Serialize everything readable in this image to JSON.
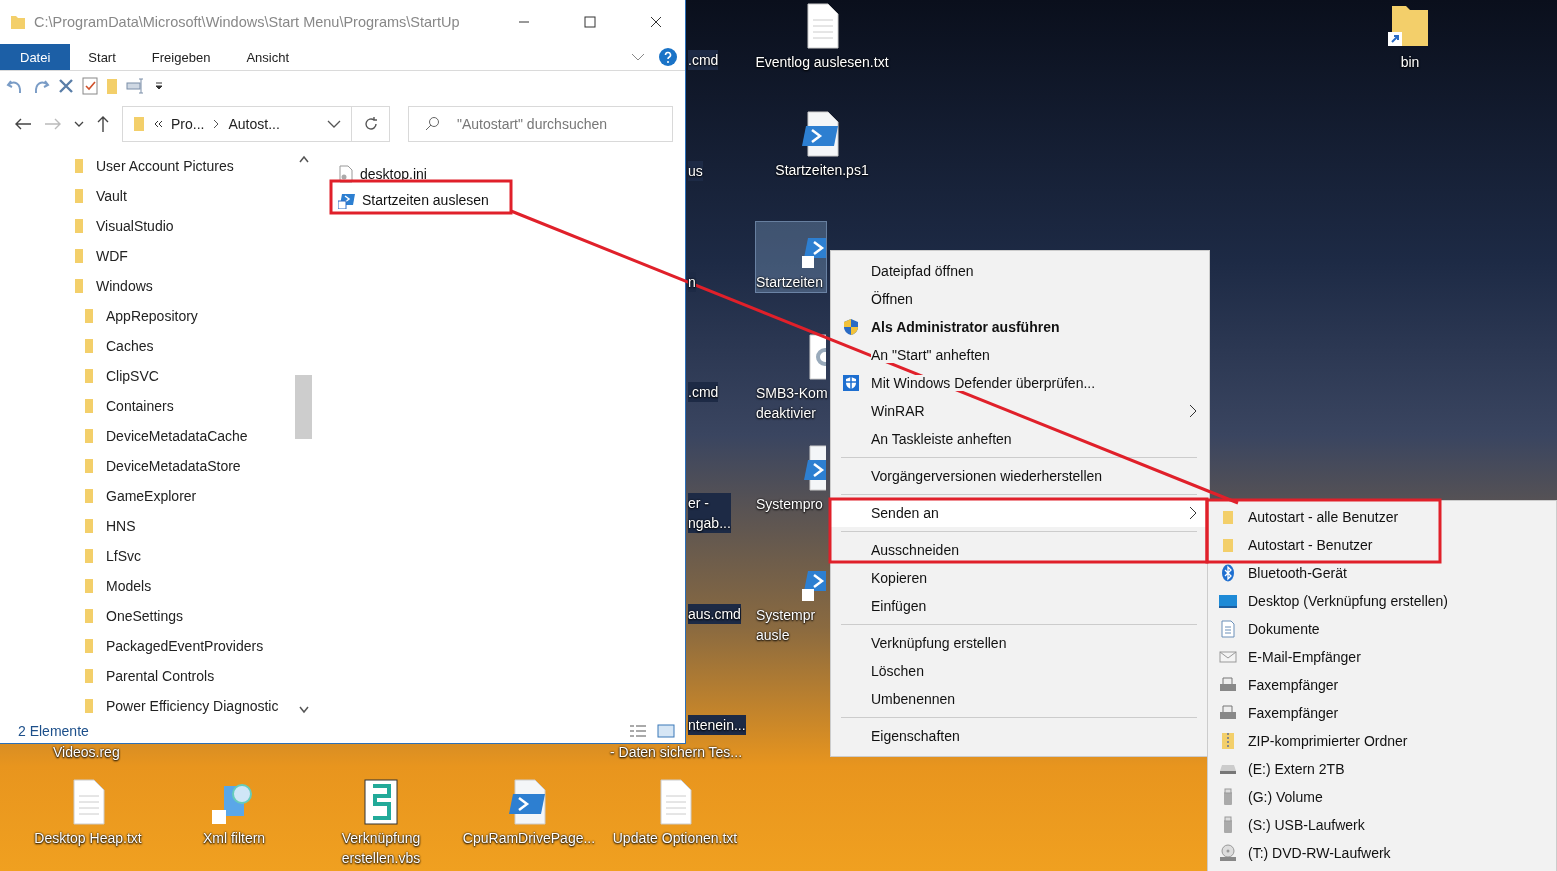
{
  "desktop_icons": [
    {
      "kind": "none",
      "lines": [
        ".cmd"
      ]
    },
    {
      "kind": "none",
      "lines": [
        "us"
      ]
    },
    {
      "kind": "none",
      "lines": [
        "n"
      ]
    },
    {
      "kind": "none",
      "lines": [
        ".cmd"
      ]
    },
    {
      "kind": "none",
      "lines": [
        "er -",
        "ngab..."
      ]
    },
    {
      "kind": "none",
      "lines": [
        "aus.cmd"
      ]
    },
    {
      "kind": "none",
      "lines": [
        "ntenein..."
      ]
    },
    {
      "kind": "none",
      "lines": [
        "Videos.reg"
      ]
    },
    {
      "kind": "none",
      "lines": [
        "- Daten sichern Tes..."
      ]
    },
    {
      "kind": "text",
      "lines": [
        "Eventlog auslesen.txt"
      ],
      "selected": false
    },
    {
      "kind": "script",
      "lines": [
        "Startzeiten.ps1"
      ],
      "selected": false
    },
    {
      "kind": "script-shortcut",
      "lines": [
        "Startzeiten"
      ],
      "selected": true
    },
    {
      "kind": "gear",
      "lines": [
        "SMB3-Kom",
        "deaktivier"
      ],
      "selected": false
    },
    {
      "kind": "script",
      "lines": [
        "Systempro"
      ],
      "selected": false
    },
    {
      "kind": "script-shortcut",
      "lines": [
        "Systempr",
        "ausle"
      ],
      "selected": false
    },
    {
      "kind": "text",
      "lines": [
        "Desktop Heap.txt"
      ],
      "selected": false
    },
    {
      "kind": "search-shortcut",
      "lines": [
        "Xml filtern"
      ],
      "selected": false
    },
    {
      "kind": "scroll",
      "lines": [
        "Verknüpfung",
        "erstellen.vbs"
      ],
      "selected": false
    },
    {
      "kind": "script",
      "lines": [
        "CpuRamDrivePage..."
      ],
      "selected": false
    },
    {
      "kind": "text",
      "lines": [
        "Update Optionen.txt"
      ],
      "selected": false
    },
    {
      "kind": "folder-shortcut",
      "lines": [
        "bin"
      ],
      "selected": false
    }
  ],
  "explorer": {
    "title": "C:\\ProgramData\\Microsoft\\Windows\\Start Menu\\Programs\\StartUp",
    "tabs": [
      {
        "label": "Datei",
        "selected": true
      },
      {
        "label": "Start",
        "selected": false
      },
      {
        "label": "Freigeben",
        "selected": false
      },
      {
        "label": "Ansicht",
        "selected": false
      }
    ],
    "breadcrumb": [
      "Pro...",
      "Autost..."
    ],
    "search": {
      "placeholder": "\"Autostart\" durchsuchen"
    },
    "tree": [
      {
        "label": "User Account Pictures"
      },
      {
        "label": "Vault"
      },
      {
        "label": "VisualStudio"
      },
      {
        "label": "WDF"
      },
      {
        "label": "Windows",
        "children": [
          {
            "label": "AppRepository"
          },
          {
            "label": "Caches"
          },
          {
            "label": "ClipSVC"
          },
          {
            "label": "Containers"
          },
          {
            "label": "DeviceMetadataCache"
          },
          {
            "label": "DeviceMetadataStore"
          },
          {
            "label": "GameExplorer"
          },
          {
            "label": "HNS"
          },
          {
            "label": "LfSvc"
          },
          {
            "label": "Models"
          },
          {
            "label": "OneSettings"
          },
          {
            "label": "PackagedEventProviders"
          },
          {
            "label": "Parental Controls"
          },
          {
            "label": "Power Efficiency Diagnostic"
          }
        ]
      }
    ],
    "files": [
      {
        "name": "desktop.ini",
        "kind": "ini"
      },
      {
        "name": "Startzeiten auslesen",
        "kind": "shortcut"
      }
    ],
    "status": "2 Elemente"
  },
  "context_menu": [
    {
      "kind": "item",
      "label": "Dateipfad öffnen"
    },
    {
      "kind": "item",
      "label": "Öffnen"
    },
    {
      "kind": "item",
      "label": "Als Administrator ausführen",
      "bold": true
    },
    {
      "kind": "item",
      "label": "An \"Start\" anheften"
    },
    {
      "kind": "item",
      "label": "Mit Windows Defender überprüfen..."
    },
    {
      "kind": "item",
      "label": "WinRAR",
      "submenu": true
    },
    {
      "kind": "item",
      "label": "An Taskleiste anheften"
    },
    {
      "kind": "separator"
    },
    {
      "kind": "item",
      "label": "Vorgängerversionen wiederherstellen"
    },
    {
      "kind": "separator"
    },
    {
      "kind": "item",
      "label": "Senden an",
      "submenu": true,
      "selected": true
    },
    {
      "kind": "separator"
    },
    {
      "kind": "item",
      "label": "Ausschneiden"
    },
    {
      "kind": "item",
      "label": "Kopieren"
    },
    {
      "kind": "item",
      "label": "Einfügen"
    },
    {
      "kind": "separator"
    },
    {
      "kind": "item",
      "label": "Verknüpfung erstellen"
    },
    {
      "kind": "item",
      "label": "Löschen"
    },
    {
      "kind": "item",
      "label": "Umbenennen"
    },
    {
      "kind": "separator"
    },
    {
      "kind": "item",
      "label": "Eigenschaften"
    }
  ],
  "send_to_menu": [
    {
      "label": "Autostart - alle Benutzer",
      "kind": "folder"
    },
    {
      "label": "Autostart - Benutzer",
      "kind": "folder"
    },
    {
      "label": "Bluetooth-Gerät",
      "kind": "bluetooth"
    },
    {
      "label": "Desktop (Verknüpfung erstellen)",
      "kind": "desktop"
    },
    {
      "label": "Dokumente",
      "kind": "document"
    },
    {
      "label": "E-Mail-Empfänger",
      "kind": "mail"
    },
    {
      "label": "Faxempfänger",
      "kind": "fax"
    },
    {
      "label": "Faxempfänger",
      "kind": "fax"
    },
    {
      "label": "ZIP-komprimierter Ordner",
      "kind": "zip"
    },
    {
      "label": "(E:) Extern 2TB",
      "kind": "drive"
    },
    {
      "label": "(G:) Volume",
      "kind": "usb"
    },
    {
      "label": "(S:) USB-Laufwerk",
      "kind": "usb"
    },
    {
      "label": "(T:) DVD-RW-Laufwerk",
      "kind": "dvd"
    }
  ]
}
